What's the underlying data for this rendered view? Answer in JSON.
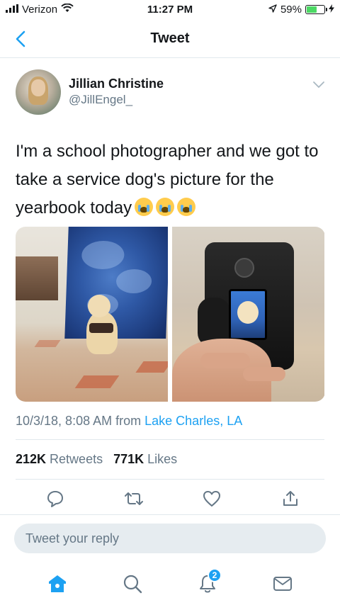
{
  "status_bar": {
    "carrier": "Verizon",
    "time": "11:27 PM",
    "battery": "59%",
    "battery_level": 0.59,
    "icons": [
      "signal-icon",
      "wifi-icon",
      "location-arrow-icon",
      "battery-icon",
      "charging-bolt-icon"
    ]
  },
  "nav": {
    "title": "Tweet",
    "back_icon": "chevron-left-icon"
  },
  "tweet": {
    "display_name": "Jillian Christine",
    "handle": "@JillEngel_",
    "text": "I'm a school photographer and we got to take a service dog's picture for the yearbook today",
    "emoji": [
      "loudly-crying-face",
      "loudly-crying-face",
      "loudly-crying-face"
    ],
    "timestamp": "10/3/18, 8:08 AM",
    "from_prefix": "from",
    "location": "Lake Charles, LA",
    "retweets_count": "212K",
    "retweets_label": "Retweets",
    "likes_count": "771K",
    "likes_label": "Likes"
  },
  "actions": [
    "reply-icon",
    "retweet-icon",
    "like-icon",
    "share-icon"
  ],
  "reply": {
    "placeholder": "Tweet your reply"
  },
  "tabbar": {
    "items": [
      "home-icon",
      "search-icon",
      "notifications-icon",
      "messages-icon"
    ],
    "notification_badge": "2"
  },
  "colors": {
    "accent": "#1da1f2",
    "text_secondary": "#657786",
    "divider": "#e1e8ed"
  }
}
